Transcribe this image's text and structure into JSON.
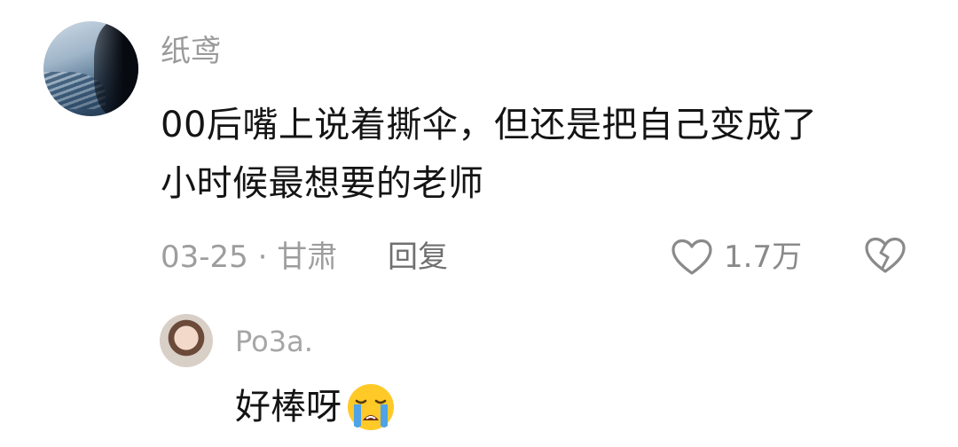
{
  "comment": {
    "username": "纸鸢",
    "text_line1": "00后嘴上说着撕伞，但还是把自己变成了",
    "text_line2": "小时候最想要的老师",
    "meta": "03-25 · 甘肃",
    "reply_label": "回复",
    "like_count": "1.7万",
    "icons": {
      "like": "heart-outline-icon",
      "dislike": "broken-heart-icon"
    }
  },
  "reply": {
    "username": "Po3a.",
    "text": "好棒呀",
    "emoji": "loudly-crying-face"
  },
  "colors": {
    "text_primary": "#141414",
    "text_secondary": "#9a9a9a",
    "emoji_yellow": "#FFC928",
    "emoji_tear": "#4FA3E6"
  }
}
